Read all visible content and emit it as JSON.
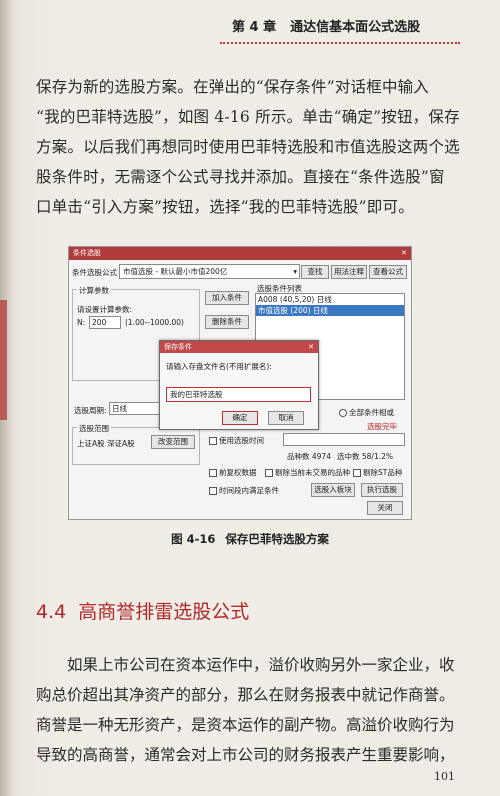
{
  "header": {
    "chapter": "第 4 章",
    "title": "通达信基本面公式选股"
  },
  "para1": [
    "保存为新的选股方案。在弹出的“保存条件”对话框中输入",
    "“我的巴菲特选股”，如图 4-16 所示。单击“确定”按钮，保存",
    "方案。以后我们再想同时使用巴菲特选股和市值选股这两个选",
    "股条件时，无需逐个公式寻找并添加。直接在“条件选股”窗",
    "口单击“引入方案”按钮，选择“我的巴菲特选股”即可。"
  ],
  "figure": {
    "window_title": "条件选股",
    "formula_label": "条件选股公式",
    "formula_value": "市值选股  - 默认最小市值200亿",
    "btn_find": "查找",
    "btn_usage": "用法注释",
    "btn_view": "查看公式",
    "params_label": "计算参数",
    "params_hint": "请设置计算参数:",
    "param_name": "N:",
    "param_value": "200",
    "param_range": "(1.00--1000.00)",
    "btn_add": "加入条件",
    "btn_delete": "删除条件",
    "list_label": "选股条件列表",
    "list_items": [
      "A008 (40,5,20) 日线",
      "市值选股 (200) 日线"
    ],
    "period_label": "选股周期:",
    "period_value": "日线",
    "all_conditions": "全部条件相或",
    "done_label": "选股完毕",
    "range_label": "选股范围",
    "range_value": "上证A股 深证A股",
    "btn_change_range": "改变范围",
    "use_time": "使用选股时间",
    "total_label": "品种数 4974",
    "selected_label": "选中数 58/1.2%",
    "chk_restore": "前复权数据",
    "chk_remove_untraded": "剔除当前未交易的品种",
    "chk_remove_st": "剔除ST品种",
    "chk_time_satisfy": "时间段内满足条件",
    "btn_import": "选股入板块",
    "btn_execute": "执行选股",
    "btn_close": "关闭",
    "dialog": {
      "title": "保存条件",
      "prompt": "请输入存盘文件名(不用扩展名):",
      "input_value": "我的巴菲特选股",
      "ok": "确定",
      "cancel": "取消"
    }
  },
  "caption": {
    "number": "图 4-16",
    "text": "保存巴菲特选股方案"
  },
  "section": {
    "number": "4.4",
    "title": "高商誉排雷选股公式"
  },
  "para2": [
    "如果上市公司在资本运作中，溢价收购另外一家企业，收",
    "购总价超出其净资产的部分，那么在财务报表中就记作商誉。",
    "商誉是一种无形资产，是资本运作的副产物。高溢价收购行为",
    "导致的高商誉，通常会对上市公司的财务报表产生重要影响，"
  ],
  "page_number": "101"
}
